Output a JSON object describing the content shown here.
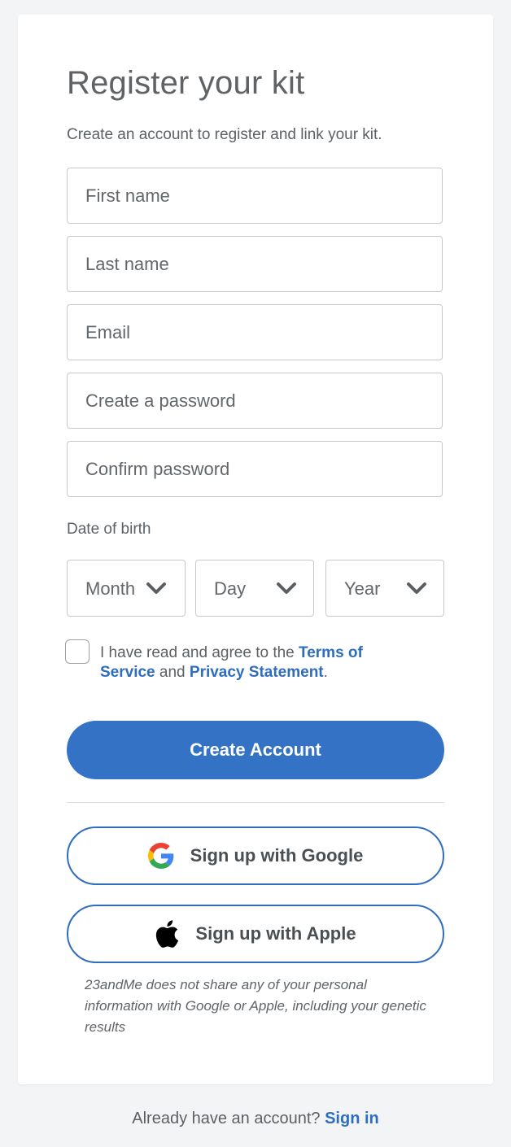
{
  "page": {
    "title": "Register your kit",
    "subtitle": "Create an account to register and link your kit."
  },
  "form": {
    "first_name_placeholder": "First name",
    "last_name_placeholder": "Last name",
    "email_placeholder": "Email",
    "password_placeholder": "Create a password",
    "confirm_password_placeholder": "Confirm password",
    "dob_label": "Date of birth",
    "month_label": "Month",
    "day_label": "Day",
    "year_label": "Year",
    "agree_prefix": "I have read and agree to the ",
    "terms_link": "Terms of Service",
    "agree_and": " and ",
    "privacy_link": "Privacy Statement",
    "agree_suffix": ".",
    "checkbox_checked": false
  },
  "actions": {
    "create_account_label": "Create Account",
    "google_label": "Sign up with Google",
    "apple_label": "Sign up with Apple",
    "google_icon": "google-g-icon",
    "apple_icon": "apple-logo-icon"
  },
  "disclaimer": "23andMe does not share any of your personal information with Google or Apple,  including your genetic results",
  "footer": {
    "prompt": "Already have an account? ",
    "sign_in_link": "Sign in"
  },
  "colors": {
    "accent": "#3372c4",
    "link": "#2f6dbe",
    "background": "#f3f4f6",
    "card": "#ffffff",
    "text": "#555b61"
  }
}
